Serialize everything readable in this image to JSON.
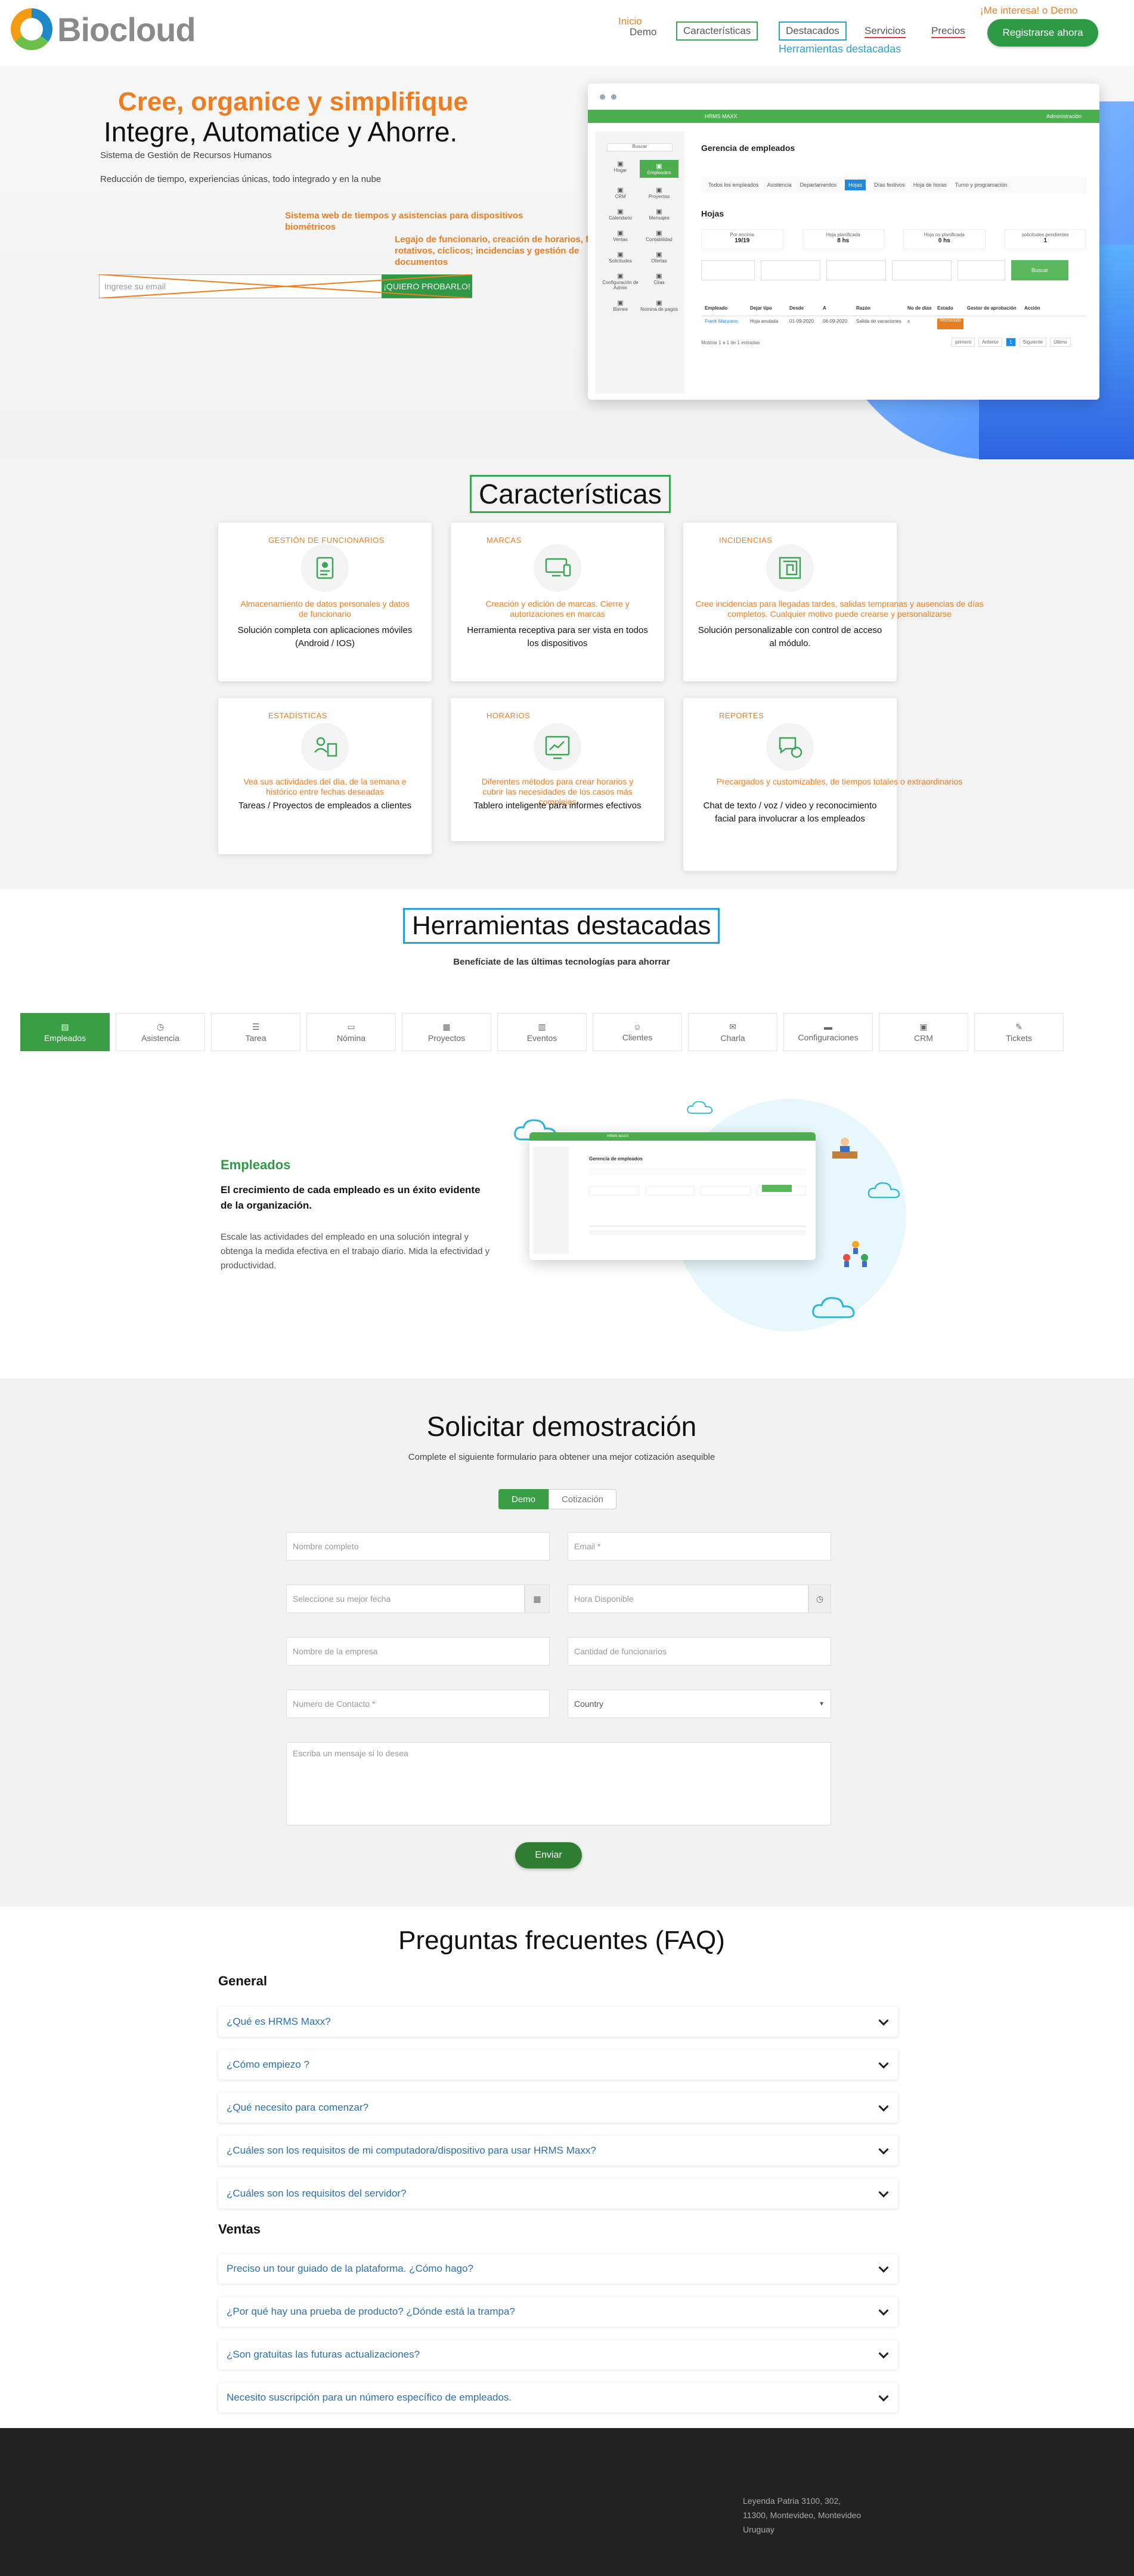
{
  "brand": {
    "name": "Biocloud"
  },
  "nav": {
    "inicio_ann": "Inicio",
    "demo": "Demo",
    "caracteristicas": "Características",
    "destacados": "Destacados",
    "servicios": "Servicios",
    "precios": "Precios",
    "interesa_ann": "¡Me interesa! o Demo",
    "herramientas_ann": "Herramientas destacadas",
    "cta": "Registrarse ahora"
  },
  "hero": {
    "slogan": "Cree, organice y simplifique",
    "title": "Integre, Automatice y Ahorre.",
    "sub1": "Sistema de Gestión de Recursos Humanos",
    "sub2": "Reducción de tiempo, experiencias únicas, todo integrado y en la nube",
    "ann1": "Sistema web de tiempos y asistencias para dispositivos biométricos",
    "ann2": "Legajo de funcionario, creación de horarios, fijos, rotativos, cíclicos; incidencias y gestión de documentos",
    "email_placeholder": "Ingrese su email",
    "email_button": "¡QUIERO PROBARLO!"
  },
  "mock": {
    "app_name": "HRMS MAXX",
    "user": "Administración",
    "search": "Buscar",
    "section": "Gerencia de empleados",
    "tabs": [
      "Todos los empleados",
      "Asistencia",
      "Departamentos",
      "Hojas",
      "Días festivos",
      "Hoja de horas",
      "Turno y programación"
    ],
    "subtitle": "Hojas",
    "stats": [
      {
        "label": "Por encima",
        "value": "19/19"
      },
      {
        "label": "Hoja planificada",
        "value": "8 hs"
      },
      {
        "label": "Hoja no planificada",
        "value": "0 hs"
      },
      {
        "label": "solicitudes pendientes",
        "value": "1"
      }
    ],
    "side_items": [
      "Hogar",
      "Empleados",
      "CRM",
      "Proyectos",
      "Calendario",
      "Mensajes",
      "Ventas",
      "Contabilidad",
      "Solicitudes",
      "Ofertas",
      "Configuración de Admin",
      "Citas",
      "Bienes",
      "Nomina de pagos"
    ],
    "table_headers": [
      "Empleado",
      "Dejar tipo",
      "Desde",
      "A",
      "Razón",
      "No de días",
      "Estado",
      "Gestor de aprobación",
      "Acción"
    ],
    "row": [
      "Frank Manzano",
      "Hoja anulada",
      "01-09-2020",
      "06-09-2020",
      "Salida de vacaciones",
      "x",
      "Rechazado",
      "",
      ""
    ],
    "footer": "Mostrar 1 a 1 de 1 entradas",
    "pagination": [
      "primero",
      "Anterior",
      "1",
      "Siguiente",
      "Último"
    ],
    "filter_btn": "Buscar"
  },
  "features": {
    "title": "Características",
    "cards": [
      {
        "ann": "GESTIÓN DE FUNCIONARIOS",
        "desc": "Almacenamiento de datos personales y datos de funcionario",
        "text": "Solución completa con aplicaciones móviles (Android / IOS)",
        "icon": "id-card-icon"
      },
      {
        "ann": "MARCAS",
        "desc": "Creación y edición de marcas. Cierre y autorizaciones en marcas",
        "text": "Herramienta receptiva para ser vista en todos los dispositivos",
        "icon": "devices-icon"
      },
      {
        "ann": "INCIDENCIAS",
        "desc": "Cree incidencias para llegadas tardes, salidas tempranas y ausencias de días completos. Cualquier motivo puede crearse y personalizarse",
        "text": "Solución personalizable con control de acceso al módulo.",
        "icon": "maze-icon"
      },
      {
        "ann": "ESTADÍSTICAS",
        "desc": "Vea sus actividades del día, de la semana e histórico entre fechas deseadas",
        "text": "Tareas / Proyectos de empleados a clientes",
        "icon": "employee-stats-icon"
      },
      {
        "ann": "HORARIOS",
        "desc": "Diferentes métodos para crear horarios y cubrir las necesidades de los casos más complejos",
        "text": "Tablero inteligente para informes efectivos",
        "icon": "dashboard-icon"
      },
      {
        "ann": "REPORTES",
        "desc": "Precargados y customizables, de tiempos totales o extraordinarios",
        "text": "Chat de texto / voz / video y reconocimiento facial para involucrar a los empleados",
        "icon": "chat-icon"
      }
    ]
  },
  "tools": {
    "title": "Herramientas destacadas",
    "subtitle": "Benefíciate de las últimas tecnologías para ahorrar",
    "tabs": [
      "Empleados",
      "Asistencia",
      "Tarea",
      "Nómina",
      "Proyectos",
      "Eventos",
      "Clientes",
      "Charla",
      "Configuraciones",
      "CRM",
      "Tickets"
    ],
    "heading": "Empleados",
    "bold": "El crecimiento de cada empleado es un éxito evidente de la organización.",
    "body": "Escale las actividades del empleado en una solución integral y obtenga la medida efectiva en el trabajo diario. Mida la efectividad y productividad."
  },
  "demo": {
    "title": "Solicitar demostración",
    "subtitle": "Complete el siguiente formulario para obtener una mejor cotización asequible",
    "toggle": [
      "Demo",
      "Cotización"
    ],
    "fields": {
      "name": "Nombre completo",
      "email": "Email *",
      "date": "Seleccione su mejor fecha",
      "time": "Hora Disponible",
      "company": "Nombre de la empresa",
      "employees": "Cantidad de funcionarios",
      "phone": "Numero de Contacto *",
      "country": "Country",
      "message": "Escriba un mensaje si lo desea"
    },
    "submit": "Enviar"
  },
  "faq": {
    "title": "Preguntas frecuentes (FAQ)",
    "general_label": "General",
    "general": [
      "¿Qué es HRMS Maxx?",
      "¿Cómo empiezo ?",
      "¿Qué necesito para comenzar?",
      "¿Cuáles son los requisitos de mi computadora/dispositivo para usar HRMS Maxx?",
      "¿Cuáles son los requisitos del servidor?"
    ],
    "ventas_label": "Ventas",
    "ventas": [
      "Preciso un tour guiado de la plataforma. ¿Cómo hago?",
      "¿Por qué hay una prueba de producto? ¿Dónde está la trampa?",
      "¿Son gratuitas las futuras actualizaciones?",
      "Necesito suscripción para un número específico de empleados."
    ]
  },
  "footer": {
    "address1": "Leyenda Patria 3100, 302,",
    "address2": "11300, Montevideo, Montevideo",
    "address3": "Uruguay"
  },
  "colors": {
    "green": "#2e9a45",
    "orange": "#f07c20",
    "blue": "#2a9fd6",
    "link": "#2a6fb0"
  }
}
